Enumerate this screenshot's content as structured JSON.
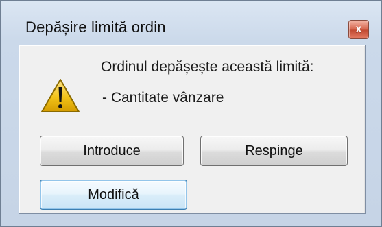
{
  "window": {
    "title": "Depășire limită ordin",
    "close_glyph": "x",
    "close_icon": "close-icon"
  },
  "dialog": {
    "icon": "warning-icon",
    "message": "Ordinul depășește această limită:",
    "detail": "- Cantitate vânzare"
  },
  "buttons": {
    "introduce": "Introduce",
    "respinge": "Respinge",
    "modifica": "Modifică"
  },
  "colors": {
    "frame": "#c6d4e6",
    "client": "#f0f0f0",
    "close": "#c24b33",
    "focus": "#3c7fb1",
    "warning": "#f2c318"
  }
}
